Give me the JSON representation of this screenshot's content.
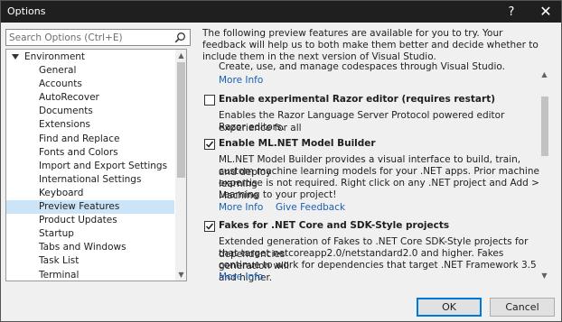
{
  "window": {
    "title": "Options",
    "help_glyph": "?",
    "close_glyph": "✕"
  },
  "search": {
    "placeholder": "Search Options (Ctrl+E)"
  },
  "tree": {
    "root": "Environment",
    "items": [
      "General",
      "Accounts",
      "AutoRecover",
      "Documents",
      "Extensions",
      "Find and Replace",
      "Fonts and Colors",
      "Import and Export Settings",
      "International Settings",
      "Keyboard",
      "Preview Features",
      "Product Updates",
      "Startup",
      "Tabs and Windows",
      "Task List",
      "Terminal"
    ],
    "selected": "Preview Features"
  },
  "intro_text": "The following preview features are available for you to try. Your feedback will help us to both make them better and decide whether to include them in the next version of Visual Studio.",
  "features": [
    {
      "title": "",
      "checked": null,
      "desc_lines": [
        "Create, use, and manage codespaces through Visual Studio."
      ],
      "more_info": "More Info",
      "feedback": ""
    },
    {
      "title": "Enable experimental Razor editor (requires restart)",
      "checked": false,
      "desc_lines": [
        "Enables the Razor Language Server Protocol powered editor experience for all",
        "Razor editors."
      ],
      "more_info": "",
      "feedback": ""
    },
    {
      "title": "Enable ML.NET Model Builder",
      "checked": true,
      "desc_lines": [
        "ML.NET Model Builder provides a visual interface to build, train, and deploy",
        "custom machine learning models for your .NET apps. Prior machine learning",
        "expertise is not required. Right click on any .NET project and Add > Machine",
        "Learning to your project!"
      ],
      "more_info": "More Info",
      "feedback": "Give Feedback"
    },
    {
      "title": "Fakes for .NET Core and SDK-Style projects",
      "checked": true,
      "desc_lines": [
        "Extended generation of Fakes to .NET Core SDK-Style projects for dependencies",
        "that target netcoreapp2.0/netstandard2.0 and higher. Fakes generation will",
        "continue to work for dependencies that target .NET Framework 3.5 and higher."
      ],
      "more_info": "More Info",
      "feedback": ""
    }
  ],
  "buttons": {
    "ok": "OK",
    "cancel": "Cancel"
  },
  "colors": {
    "titlebar": "#1f1f1f",
    "selection": "#cce4f7",
    "link": "#1a5fb4",
    "accent": "#0078d7"
  }
}
